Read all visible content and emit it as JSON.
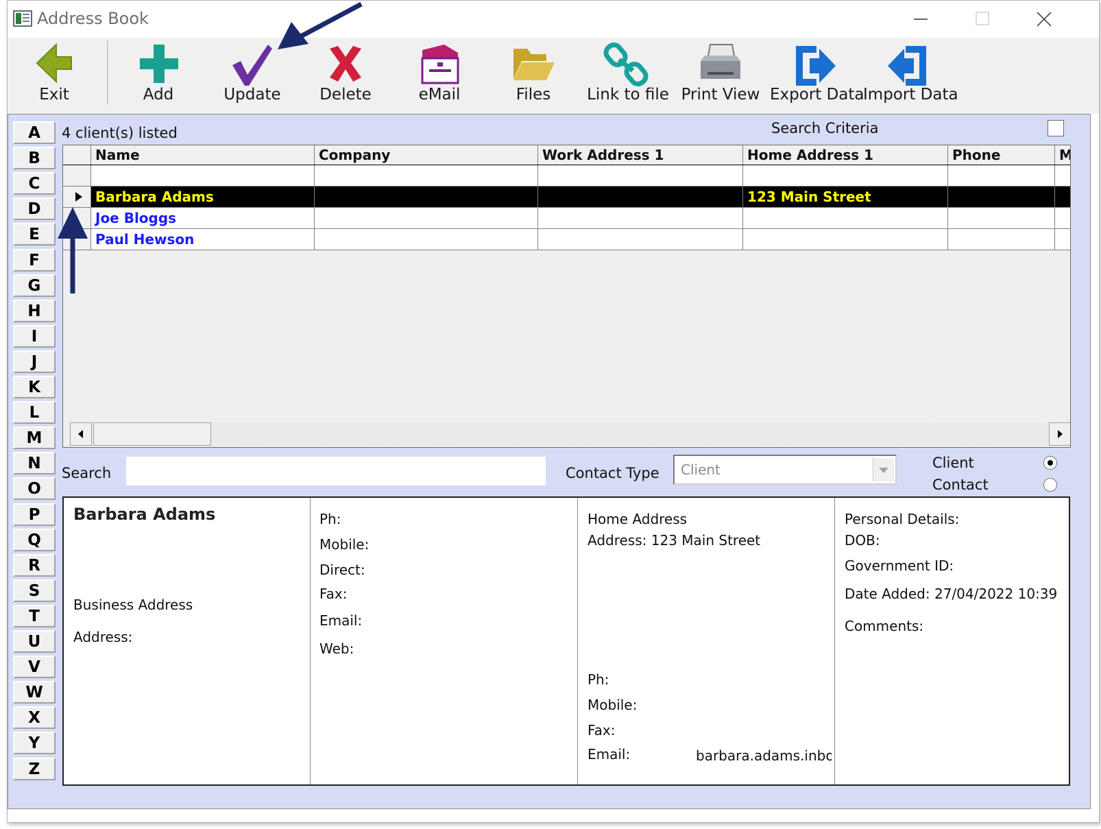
{
  "window": {
    "title": "Address Book",
    "controls": {
      "minimize": "minimize-icon",
      "maximize": "maximize-icon",
      "close": "close-icon"
    }
  },
  "toolbar": {
    "exit": "Exit",
    "add": "Add",
    "update": "Update",
    "delete": "Delete",
    "email": "eMail",
    "files": "Files",
    "link_to_file": "Link to file",
    "print_view": "Print View",
    "export_data": "Export Data",
    "import_data": "Import Data"
  },
  "alphabet": [
    "A",
    "B",
    "C",
    "D",
    "E",
    "F",
    "G",
    "H",
    "I",
    "J",
    "K",
    "L",
    "M",
    "N",
    "O",
    "P",
    "Q",
    "R",
    "S",
    "T",
    "U",
    "V",
    "W",
    "X",
    "Y",
    "Z"
  ],
  "list": {
    "status": "4 client(s) listed",
    "search_criteria_label": "Search Criteria",
    "columns": [
      "Name",
      "Company",
      "Work Address 1",
      "Home Address 1",
      "Phone",
      "M"
    ],
    "rows": [
      {
        "name": "Barbara  Adams",
        "company": "",
        "work": "",
        "home": "123 Main Street",
        "phone": "",
        "selected": true
      },
      {
        "name": "Joe  Bloggs",
        "company": "",
        "work": "",
        "home": "",
        "phone": "",
        "selected": false
      },
      {
        "name": "Paul  Hewson",
        "company": "",
        "work": "",
        "home": "",
        "phone": "",
        "selected": false
      }
    ]
  },
  "search": {
    "label": "Search",
    "value": "",
    "contact_type_label": "Contact Type",
    "contact_type_value": "Client",
    "radio_client": "Client",
    "radio_contact": "Contact"
  },
  "detail": {
    "name": "Barbara  Adams",
    "business_address": "Business Address",
    "address_label": "Address:",
    "ph": "Ph:",
    "mobile": "Mobile:",
    "direct": "Direct:",
    "fax": "Fax:",
    "email": "Email:",
    "web": "Web:",
    "home_address": "Home Address",
    "home_address_line": "Address:  123 Main Street",
    "home_ph": "Ph:",
    "home_mobile": "Mobile:",
    "home_fax": "Fax:",
    "home_email": "Email:",
    "home_email_value": "barbara.adams.inbo",
    "personal_details": "Personal Details:",
    "dob": "DOB:",
    "government_id": "Government ID:",
    "date_added": "Date Added:  27/04/2022 10:39",
    "comments": "Comments:"
  },
  "colors": {
    "panel_bg": "#d6dcf5",
    "selected_row_bg": "#000000",
    "selected_row_text": "#ffff00",
    "row_text": "#1c1cff",
    "annotation_arrow": "#1b2a6b"
  }
}
